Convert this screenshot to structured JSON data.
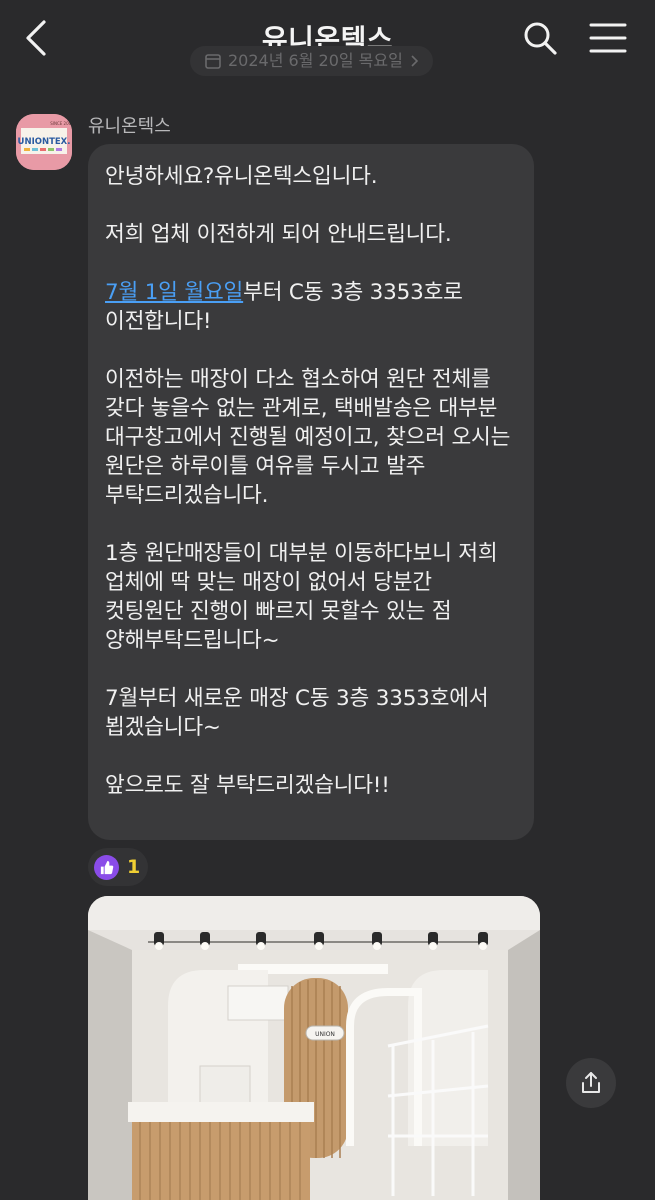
{
  "header": {
    "title": "유니온텍스",
    "date_divider": "2024년 6월 20일 목요일"
  },
  "message": {
    "sender": "유니온텍스",
    "avatar_text": "UNIONTEX.",
    "avatar_badge": "SINCE 2004",
    "paragraphs": {
      "p1": "안녕하세요?유니온텍스입니다.",
      "p2": "저희 업체 이전하게 되어 안내드립니다.",
      "p3_link": "7월 1일 월요일",
      "p3_rest": "부터 C동 3층 3353호로 이전합니다!",
      "p4": "이전하는 매장이 다소 협소하여 원단 전체를 갖다 놓을수 없는 관계로, 택배발송은 대부분 대구창고에서 진행될 예정이고, 찾으러 오시는 원단은 하루이틀 여유를 두시고 발주 부탁드리겠습니다.",
      "p5": "1층 원단매장들이 대부분 이동하다보니 저희 업체에 딱 맞는 매장이 없어서 당분간 컷팅원단 진행이 빠르지 못할수 있는 점 양해부탁드립니다~",
      "p6": "7월부터 새로운 매장 C동 3층 3353호에서 뵙겠습니다~",
      "p7": "앞으로도 잘 부탁드리겠습니다!!"
    }
  },
  "reaction": {
    "icon": "thumbs-up-icon",
    "count": "1"
  },
  "photo": {
    "sign_text": "UNION"
  },
  "colors": {
    "background": "#2a2a2c",
    "bubble": "#3a3a3c",
    "link": "#4a9ff5",
    "reaction_count": "#f0cf33",
    "reaction_icon": "#8a4ce8"
  }
}
